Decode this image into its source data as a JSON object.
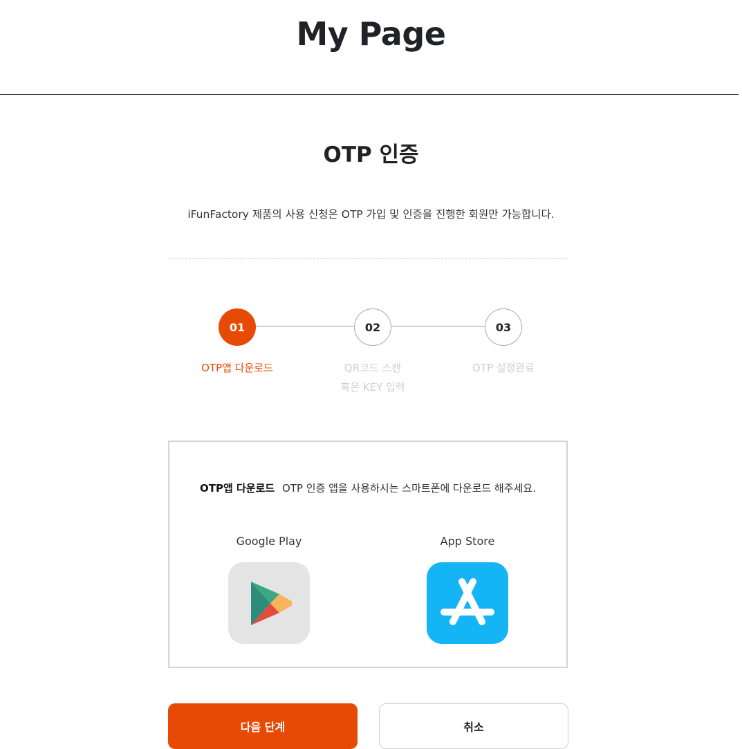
{
  "header": {
    "title": "My Page"
  },
  "section": {
    "title": "OTP 인증",
    "description": "iFunFactory 제품의 사용 신청은 OTP 가입 및 인증을 진행한 회원만 가능합니다."
  },
  "steps": [
    {
      "number": "01",
      "label_line1": "OTP앱 다운로드",
      "label_line2": ""
    },
    {
      "number": "02",
      "label_line1": "QR코드 스캔",
      "label_line2": "혹은 KEY 입력"
    },
    {
      "number": "03",
      "label_line1": "OTP 설정완료",
      "label_line2": ""
    }
  ],
  "download": {
    "title": "OTP앱 다운로드",
    "description": "OTP 인증 앱을 사용하시는 스마트폰에 다운로드 해주세요.",
    "stores": [
      {
        "label": "Google Play",
        "icon": "google-play-icon"
      },
      {
        "label": "App Store",
        "icon": "app-store-icon"
      }
    ]
  },
  "buttons": {
    "next_label": "다음 단계",
    "cancel_label": "취소"
  },
  "colors": {
    "accent": "#e64a05",
    "inactive_text": "#cfcfcf",
    "app_store_blue": "#14b4f5",
    "google_play_bg": "#e4e4e4"
  }
}
